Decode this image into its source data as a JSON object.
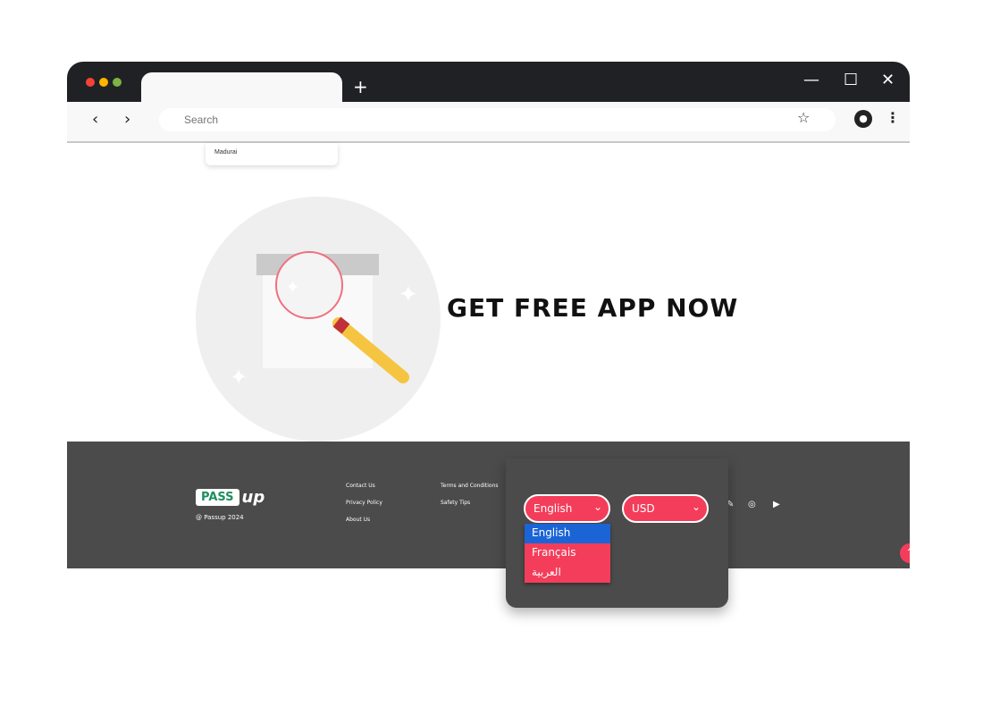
{
  "browser": {
    "search_placeholder": "Search",
    "new_tab": "+",
    "suggestion": "Madurai"
  },
  "hero": {
    "cta": "GET FREE APP NOW"
  },
  "footer": {
    "logo_pass": "PASS",
    "logo_up": "up",
    "copyright": "@ Passup 2024",
    "links_col1": [
      "Contact Us",
      "Privacy Policy",
      "About Us"
    ],
    "links_col2": [
      "Terms and Conditions",
      "Safety Tips"
    ]
  },
  "settings": {
    "language": "English",
    "currency": "USD",
    "language_options": [
      "English",
      "Français",
      "العربية"
    ],
    "selected_option": "English"
  },
  "colors": {
    "accent": "#f43d5a",
    "highlight": "#1b64d6",
    "footer": "#4a4b4a",
    "titlebar": "#202124"
  }
}
